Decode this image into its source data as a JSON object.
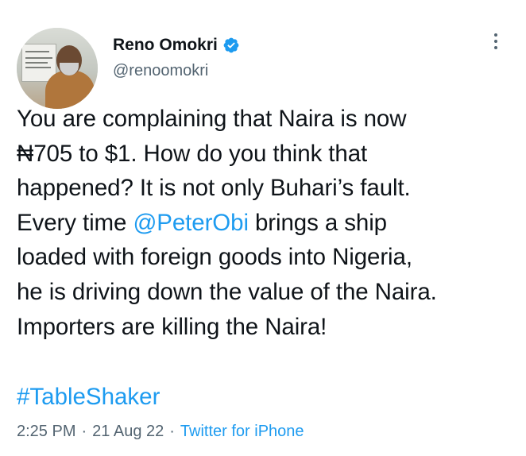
{
  "tweet": {
    "author": {
      "display_name": "Reno Omokri",
      "handle": "@renoomokri",
      "verified": true,
      "verified_icon": "verified-badge-icon"
    },
    "text_lines": [
      "You are complaining that Naira is now",
      "₦705 to $1. How do you think that",
      "happened? It is not only Buhari’s fault.",
      "loaded with foreign goods into Nigeria,",
      "he is driving down the value of the Naira.",
      "Importers are killing the Naira!"
    ],
    "mention_line": {
      "prefix": "Every time ",
      "mention": "@PeterObi",
      "suffix": " brings a ship"
    },
    "hashtag": "#TableShaker",
    "timestamp_time": "2:25 PM",
    "separator": "·",
    "timestamp_date": "21 Aug 22",
    "source": "Twitter for iPhone"
  },
  "icons": {
    "more": "more-options-icon",
    "verified": "verified-badge-icon"
  },
  "colors": {
    "link": "#1d9bf0",
    "secondary_text": "#536471",
    "primary_text": "#0f1419"
  }
}
